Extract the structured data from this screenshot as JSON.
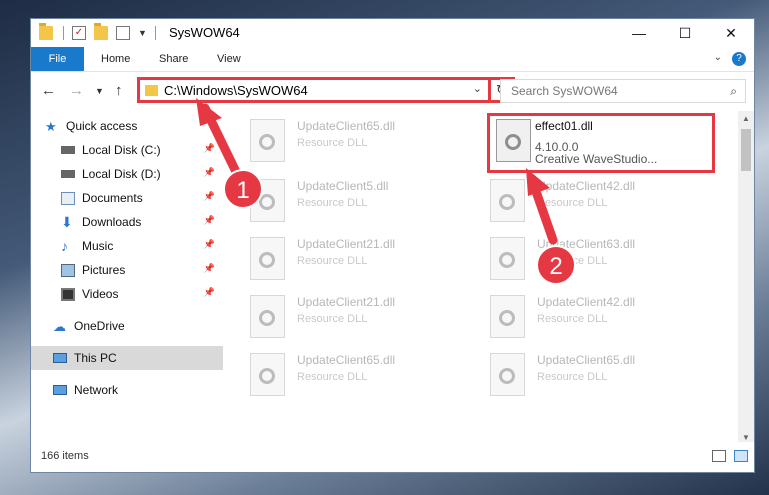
{
  "window": {
    "title": "SysWOW64",
    "buttons": {
      "minimize": "—",
      "maximize": "☐",
      "close": "✕"
    }
  },
  "ribbon": {
    "file_tab": "File",
    "tabs": [
      "Home",
      "Share",
      "View"
    ]
  },
  "address_bar": {
    "path": "C:\\Windows\\SysWOW64"
  },
  "search": {
    "placeholder": "Search SysWOW64"
  },
  "sidebar": {
    "items": [
      {
        "label": "Quick access",
        "icon": "star-icon",
        "pinned": false
      },
      {
        "label": "Local Disk (C:)",
        "icon": "drive-icon",
        "pinned": true
      },
      {
        "label": "Local Disk (D:)",
        "icon": "drive-icon",
        "pinned": true
      },
      {
        "label": "Documents",
        "icon": "documents-icon",
        "pinned": true
      },
      {
        "label": "Downloads",
        "icon": "download-icon",
        "pinned": true
      },
      {
        "label": "Music",
        "icon": "music-icon",
        "pinned": true
      },
      {
        "label": "Pictures",
        "icon": "pictures-icon",
        "pinned": true
      },
      {
        "label": "Videos",
        "icon": "videos-icon",
        "pinned": true
      },
      {
        "label": "OneDrive",
        "icon": "cloud-icon",
        "pinned": false
      },
      {
        "label": "This PC",
        "icon": "computer-icon",
        "pinned": false,
        "selected": true
      },
      {
        "label": "Network",
        "icon": "network-icon",
        "pinned": false
      }
    ]
  },
  "files": [
    {
      "name": "UpdateClient65.dll",
      "type": "Resource DLL"
    },
    {
      "name": "effect01.dll",
      "version": "4.10.0.0",
      "company": "Creative WaveStudio...",
      "highlighted": true
    },
    {
      "name": "UpdateClient5.dll",
      "type": "Resource DLL"
    },
    {
      "name": "UpdateClient42.dll",
      "type": "Resource DLL"
    },
    {
      "name": "UpdateClient21.dll",
      "type": "Resource DLL"
    },
    {
      "name": "UpdateClient63.dll",
      "type": "Resource DLL"
    },
    {
      "name": "UpdateClient21.dll",
      "type": "Resource DLL"
    },
    {
      "name": "UpdateClient42.dll",
      "type": "Resource DLL"
    },
    {
      "name": "UpdateClient65.dll",
      "type": "Resource DLL"
    },
    {
      "name": "UpdateClient65.dll",
      "type": "Resource DLL"
    }
  ],
  "status": {
    "item_count": "166 items"
  },
  "annotations": {
    "step1": "1",
    "step2": "2",
    "color": "#e53843"
  }
}
